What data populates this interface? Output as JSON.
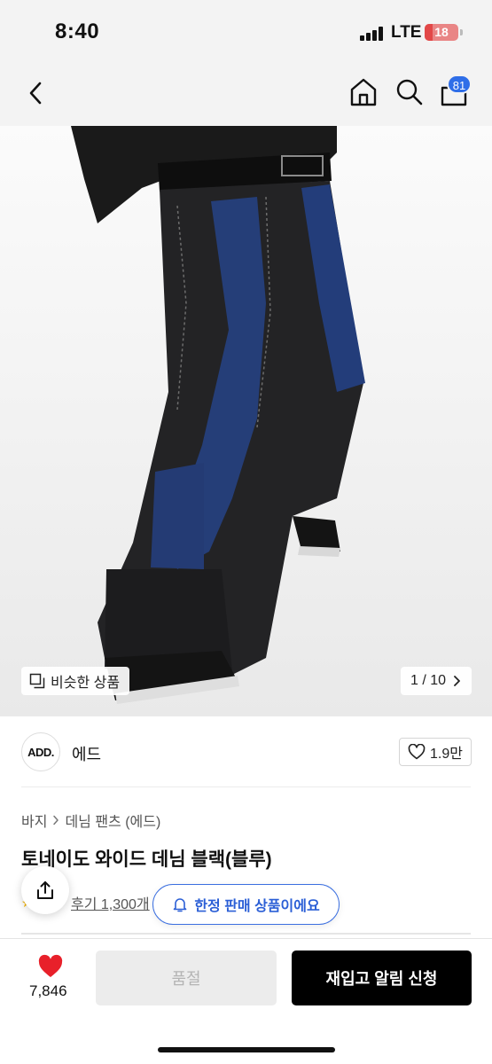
{
  "status_bar": {
    "time": "8:40",
    "network": "LTE",
    "battery": "18"
  },
  "nav": {
    "cart_count": "81"
  },
  "product_image": {
    "similar_label": "비슷한 상품",
    "pager": "1 / 10"
  },
  "brand": {
    "logo_text": "ADD.",
    "name": "에드",
    "likes": "1.9만"
  },
  "breadcrumb": {
    "items": [
      "바지",
      "데님 팬츠 (에드)"
    ]
  },
  "product": {
    "title": "토네이도 와이드 데님 블랙(블루)",
    "review_text": "후기 1,300개"
  },
  "limited_chip": "한정 판매 상품이에요",
  "bottom_bar": {
    "wish_count": "7,846",
    "soldout_label": "품절",
    "restock_label": "재입고 알림 신청"
  },
  "colors": {
    "accent": "#2f6ee8",
    "wish": "#e8202a",
    "primary_button": "#000000"
  },
  "icons": [
    "back-icon",
    "home-icon",
    "search-icon",
    "shopping-bag-icon",
    "similar-items-icon",
    "chevron-right-icon",
    "heart-outline-icon",
    "share-icon",
    "bell-icon",
    "heart-filled-icon"
  ]
}
